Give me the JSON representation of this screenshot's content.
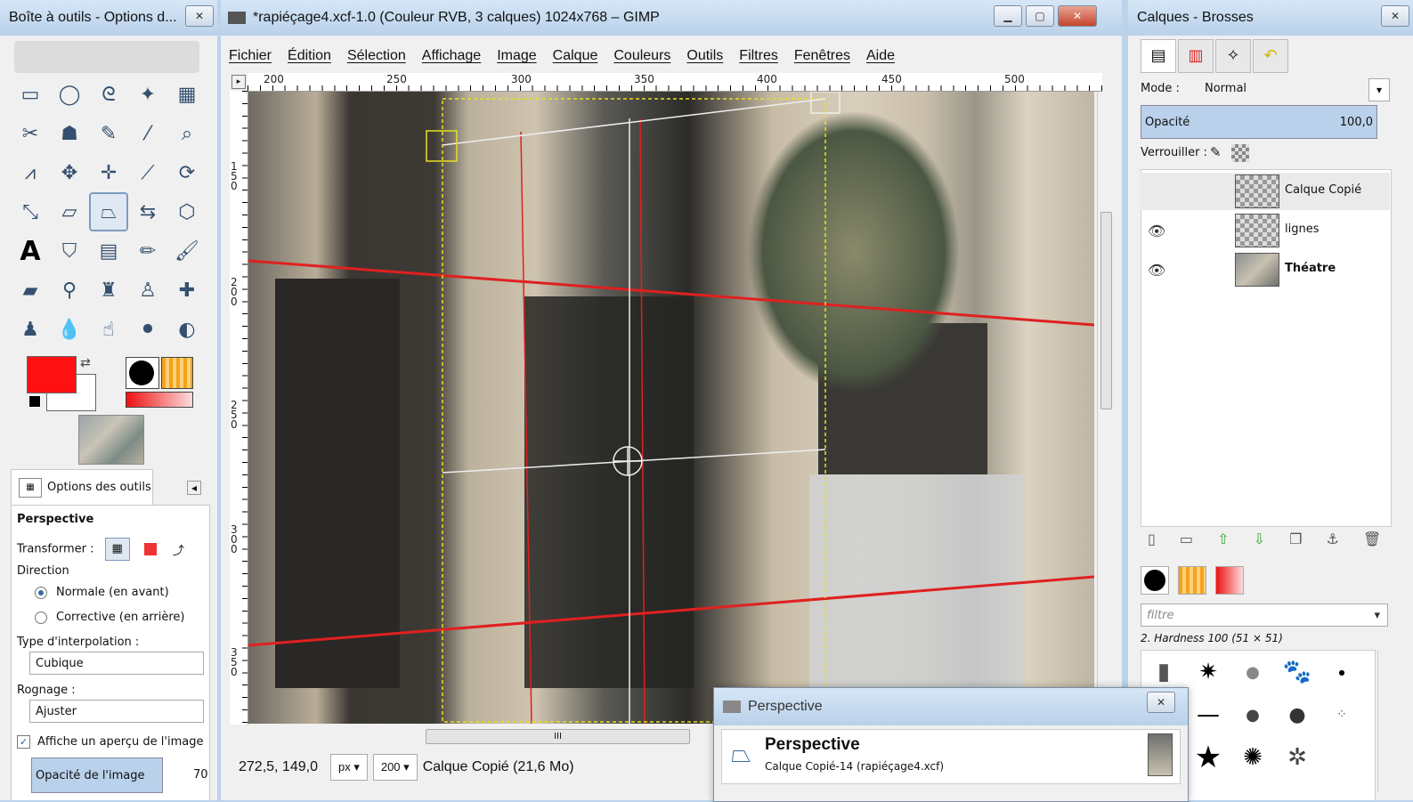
{
  "toolbox": {
    "title": "Boîte à outils - Options d...",
    "options_tab": "Options des outils",
    "tool_name": "Perspective",
    "transformer_label": "Transformer :",
    "direction_label": "Direction",
    "direction_options": [
      "Normale (en avant)",
      "Corrective (en arrière)"
    ],
    "interpolation_label": "Type d'interpolation :",
    "interpolation_value": "Cubique",
    "clipping_label": "Rognage :",
    "clipping_value": "Ajuster",
    "preview_label": "Affiche un aperçu de l'image",
    "opacity_label": "Opacité de l'image",
    "opacity_value": "70"
  },
  "image_window": {
    "title": "*rapiéçage4.xcf-1.0 (Couleur RVB, 3 calques) 1024x768 – GIMP",
    "menu": [
      "Fichier",
      "Édition",
      "Sélection",
      "Affichage",
      "Image",
      "Calque",
      "Couleurs",
      "Outils",
      "Filtres",
      "Fenêtres",
      "Aide"
    ],
    "ruler_h": [
      "200",
      "250",
      "300",
      "350",
      "400",
      "450",
      "500"
    ],
    "ruler_v": [
      "150",
      "200",
      "250",
      "300",
      "350"
    ],
    "scroll_label": "III",
    "coords": "272,5, 149,0",
    "unit": "px",
    "zoom": "200",
    "status": "Calque Copié (21,6 Mo)"
  },
  "dock": {
    "title": "Calques - Brosses",
    "mode_label": "Mode :",
    "mode_value": "Normal",
    "opacity_label": "Opacité",
    "opacity_value": "100,0",
    "lock_label": "Verrouiller :",
    "layers": [
      {
        "name": "Calque Copié",
        "visible": false
      },
      {
        "name": "lignes",
        "visible": true
      },
      {
        "name": "Théatre",
        "visible": true
      }
    ],
    "filter_placeholder": "filtre",
    "brush_name": "2. Hardness 100 (51 × 51)"
  },
  "perspective_dialog": {
    "title": "Perspective",
    "heading": "Perspective",
    "subtitle": "Calque Copié-14 (rapiéçage4.xcf)"
  },
  "colors": {
    "foreground": "#ff1a1a",
    "background": "#ffffff",
    "guide_line": "#e02020"
  }
}
